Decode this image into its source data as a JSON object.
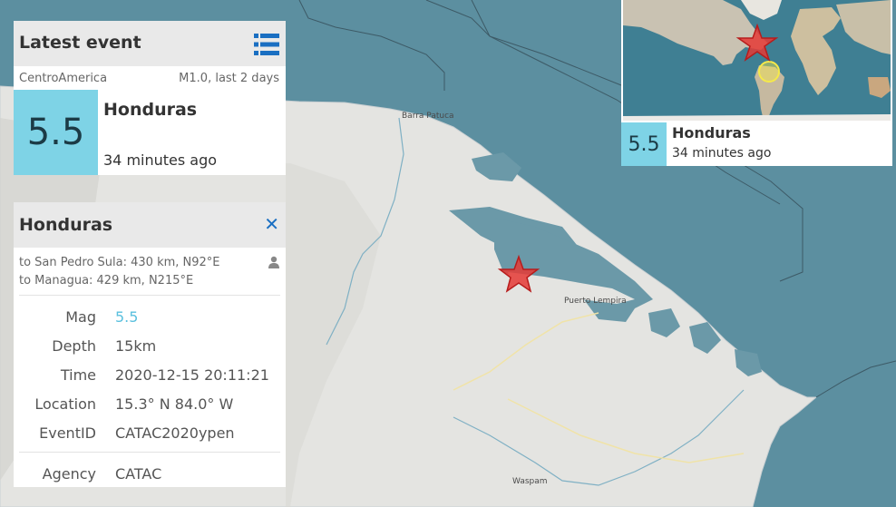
{
  "map": {
    "labels": {
      "barra_patuca": "Barra Patuca",
      "puerto_lempira": "Puerto Lempira",
      "waspam": "Waspam"
    },
    "colors": {
      "ocean": "#5c8fa0",
      "land": "#e4e4e1",
      "lagoon": "#5c8fa0",
      "epicenter": "#e53935"
    }
  },
  "latest_event": {
    "title": "Latest event",
    "region": "CentroAmerica",
    "filter": "M1.0, last 2 days",
    "magnitude": "5.5",
    "place": "Honduras",
    "time_ago": "34 minutes ago",
    "icons": {
      "list": "list-icon"
    }
  },
  "event_detail": {
    "title": "Honduras",
    "distance_1": "to San Pedro Sula: 430 km, N92°E",
    "distance_2": "to Managua: 429 km, N215°E",
    "icons": {
      "close": "close-icon",
      "felt": "person-icon"
    },
    "fields": {
      "mag_label": "Mag",
      "mag_value": "5.5",
      "depth_label": "Depth",
      "depth_value": "15km",
      "time_label": "Time",
      "time_value": "2020-12-15 20:11:21",
      "location_label": "Location",
      "location_value": "15.3° N 84.0° W",
      "eventid_label": "EventID",
      "eventid_value": "CATAC2020ypen",
      "agency_label": "Agency",
      "agency_value": "CATAC"
    },
    "colors": {
      "magnitude": "#5bc0de",
      "close": "#1a6fc2"
    }
  },
  "inset": {
    "magnitude": "5.5",
    "place": "Honduras",
    "time_ago": "34 minutes ago",
    "colors": {
      "magbox": "#7ed3e6",
      "marker_star": "#e53935",
      "marker_circle": "#f5e94a"
    }
  }
}
